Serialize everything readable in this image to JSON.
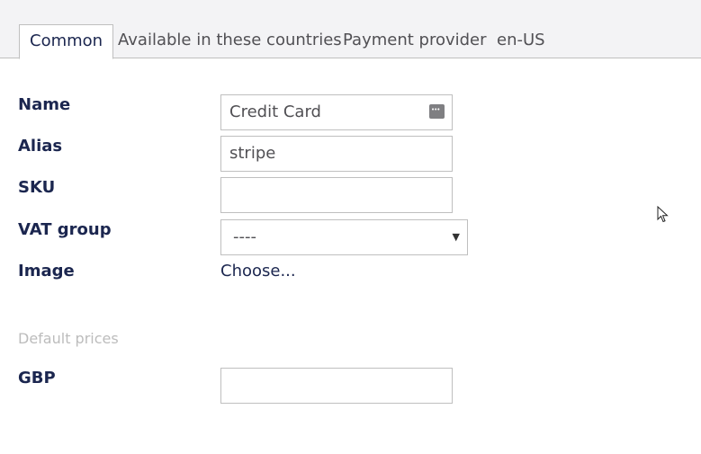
{
  "tabs": [
    {
      "label": "Common"
    },
    {
      "label": "Available in these countries"
    },
    {
      "label": "Payment provider"
    },
    {
      "label": "en-US"
    }
  ],
  "form": {
    "name": {
      "label": "Name",
      "value": "Credit Card"
    },
    "alias": {
      "label": "Alias",
      "value": "stripe"
    },
    "sku": {
      "label": "SKU",
      "value": ""
    },
    "vat_group": {
      "label": "VAT group",
      "selected": "----"
    },
    "image": {
      "label": "Image",
      "action": "Choose..."
    }
  },
  "default_prices": {
    "title": "Default prices",
    "gbp": {
      "label": "GBP",
      "value": ""
    }
  }
}
